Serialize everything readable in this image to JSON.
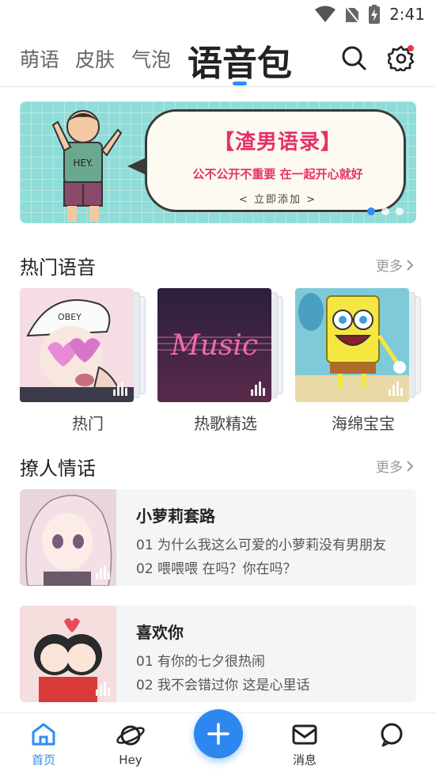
{
  "status_bar": {
    "time": "2:41"
  },
  "top_nav": {
    "tabs": [
      {
        "label": "萌语"
      },
      {
        "label": "皮肤"
      },
      {
        "label": "气泡"
      },
      {
        "label": "语音包"
      }
    ],
    "active_tab": "语音包"
  },
  "banner": {
    "shirt_text": "HEY.",
    "title": "【渣男语录】",
    "subtitle": "公不公开不重要 在一起开心就好",
    "button": "< 立即添加 >",
    "slide_count": 3,
    "active_slide": 1
  },
  "hot_voice": {
    "title": "热门语音",
    "more": "更多",
    "items": [
      {
        "label": "热门",
        "cap_text": "OBEY"
      },
      {
        "label": "热歌精选",
        "art_text": "Music"
      },
      {
        "label": "海绵宝宝"
      }
    ]
  },
  "flirt": {
    "title": "撩人情话",
    "more": "更多",
    "items": [
      {
        "title": "小萝莉套路",
        "line1": "01 为什么我这么可爱的小萝莉没有男朋友",
        "line2": "02 喂喂喂 在吗？你在吗？"
      },
      {
        "title": "喜欢你",
        "line1": "01 有你的七夕很热闹",
        "line2": "02 我不会错过你 这是心里话"
      }
    ]
  },
  "bottom_nav": {
    "items": [
      {
        "label": "首页"
      },
      {
        "label": "Hey"
      },
      {
        "label": "消息"
      },
      {
        "label": ""
      }
    ],
    "active": "首页"
  },
  "colors": {
    "accent": "#2f8ef5",
    "banner_bg": "#8fdcd8",
    "banner_text": "#e6306c"
  }
}
